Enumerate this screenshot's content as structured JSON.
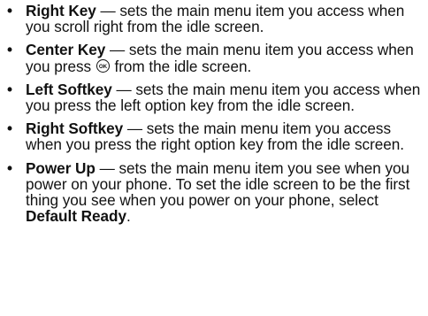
{
  "items": [
    {
      "bullet": "•",
      "term": "Right Key",
      "text": " — sets the main menu item you access when you scroll right from the idle screen."
    },
    {
      "bullet": "•",
      "term": "Center Key",
      "text_before_icon": " — sets the main menu item you access when you press ",
      "icon": "ok-key-icon",
      "text_after_icon": " from the idle screen."
    },
    {
      "bullet": "•",
      "term": "Left Softkey",
      "text": " — sets the main menu item you access when you press the left option key from the idle screen."
    },
    {
      "bullet": "•",
      "term": "Right Softkey",
      "text": " — sets the main menu item you access when you press the right option key from the idle screen."
    },
    {
      "bullet": "•",
      "term": "Power Up",
      "text": " — sets the main menu item you see when you power on your phone. To set the idle screen to be the first thing you see when you power on your phone, select ",
      "strong": "Default Ready",
      "text_end": "."
    }
  ]
}
